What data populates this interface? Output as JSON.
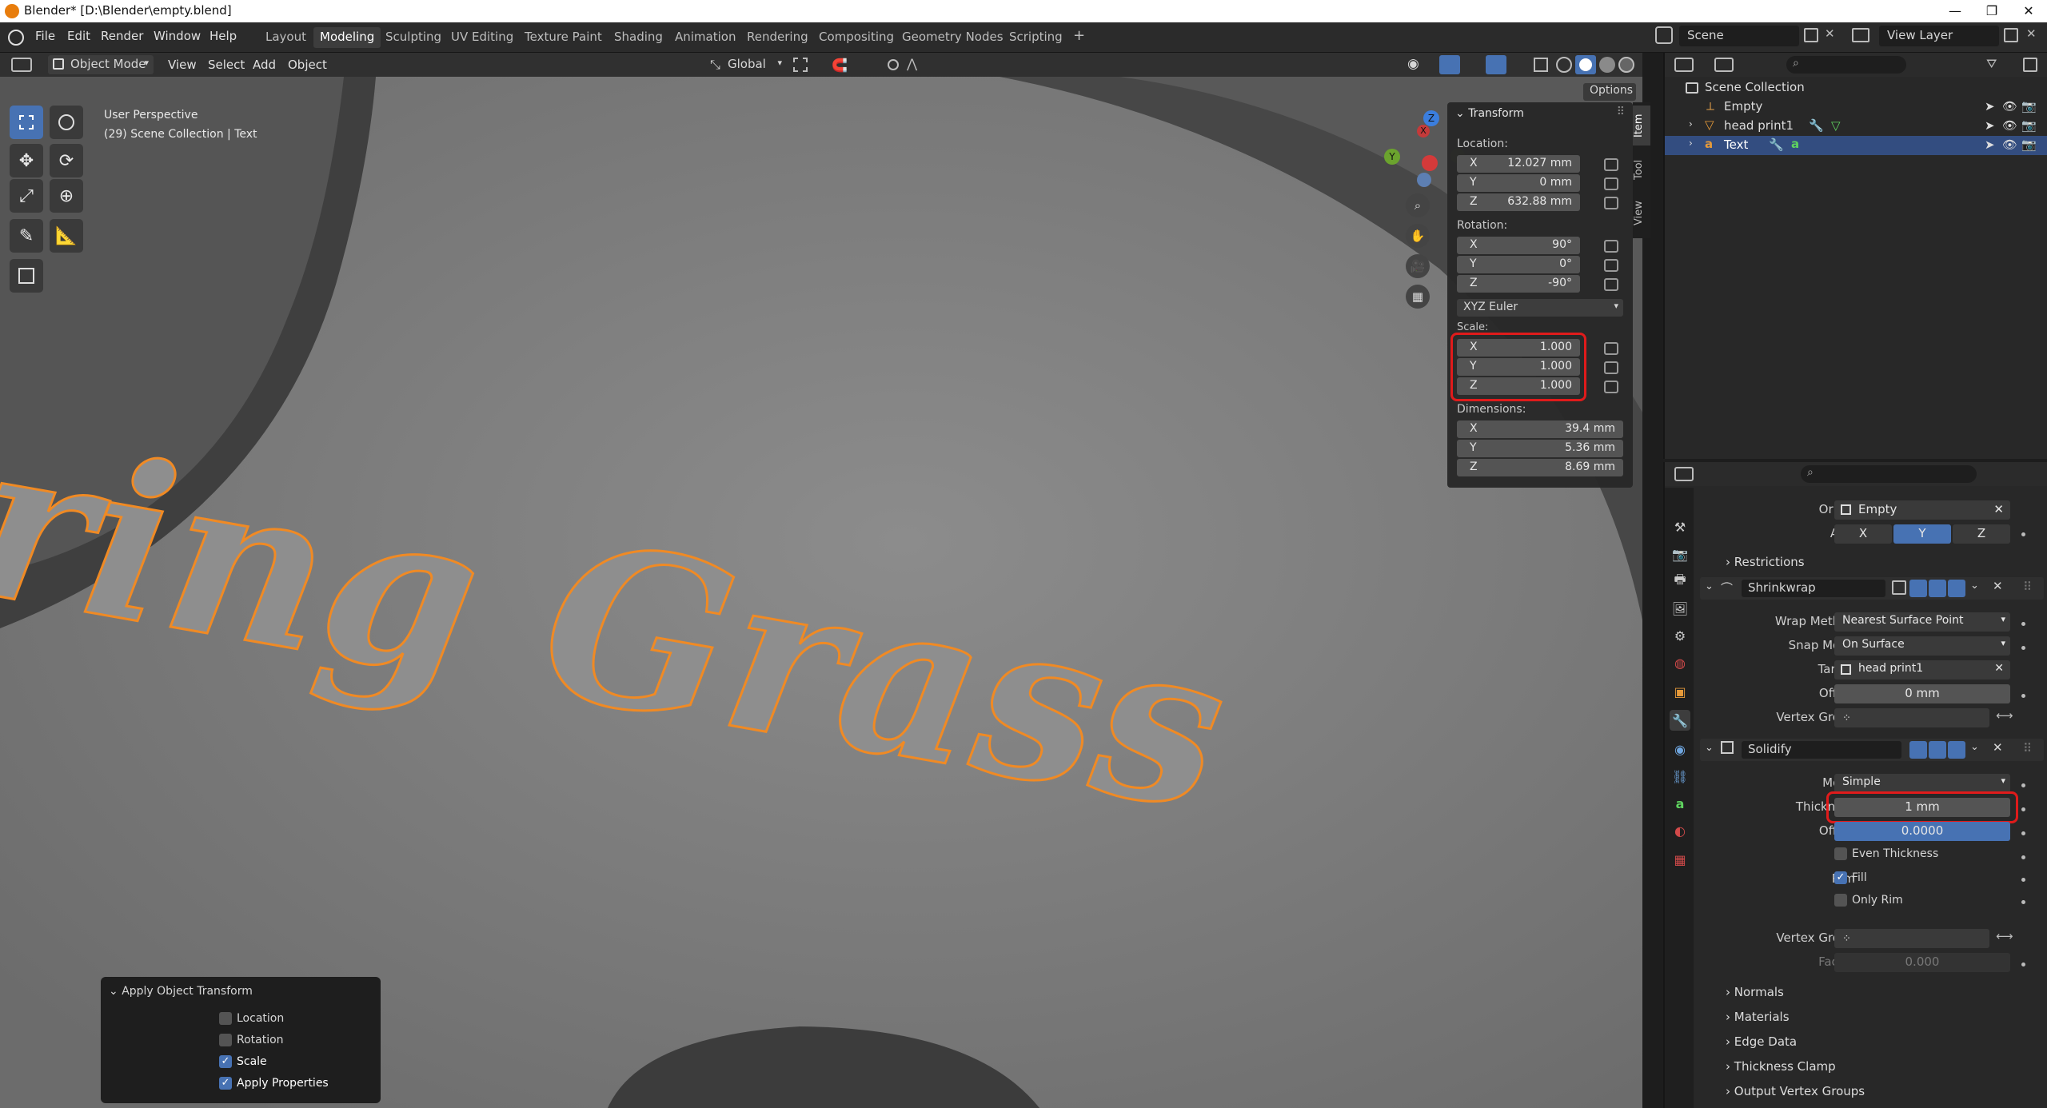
{
  "window": {
    "title": "Blender* [D:\\Blender\\empty.blend]",
    "minimize": "—",
    "restore": "❐",
    "close": "✕"
  },
  "menu": [
    "File",
    "Edit",
    "Render",
    "Window",
    "Help"
  ],
  "workspaces": [
    "Layout",
    "Modeling",
    "Sculpting",
    "UV Editing",
    "Texture Paint",
    "Shading",
    "Animation",
    "Rendering",
    "Compositing",
    "Geometry Nodes",
    "Scripting"
  ],
  "active_workspace": "Modeling",
  "add_workspace": "+",
  "scene": {
    "label": "Scene",
    "view_layer": "View Layer"
  },
  "viewport_header": {
    "mode": "Object Mode",
    "menus": [
      "View",
      "Select",
      "Add",
      "Object"
    ],
    "transform_orientation": "Global",
    "options": "Options"
  },
  "viewport": {
    "perspective": "User Perspective",
    "collection_info": "(29) Scene Collection | Text",
    "scene_text": "ring Grass"
  },
  "gizmo": {
    "z": "Z",
    "y": "Y",
    "x": "X"
  },
  "transform_panel": {
    "title": "Transform",
    "location_label": "Location:",
    "location": [
      {
        "axis": "X",
        "value": "12.027 mm"
      },
      {
        "axis": "Y",
        "value": "0 mm"
      },
      {
        "axis": "Z",
        "value": "632.88 mm"
      }
    ],
    "rotation_label": "Rotation:",
    "rotation": [
      {
        "axis": "X",
        "value": "90°"
      },
      {
        "axis": "Y",
        "value": "0°"
      },
      {
        "axis": "Z",
        "value": "-90°"
      }
    ],
    "rotation_mode": "XYZ Euler",
    "scale_label": "Scale:",
    "scale": [
      {
        "axis": "X",
        "value": "1.000"
      },
      {
        "axis": "Y",
        "value": "1.000"
      },
      {
        "axis": "Z",
        "value": "1.000"
      }
    ],
    "dimensions_label": "Dimensions:",
    "dimensions": [
      {
        "axis": "X",
        "value": "39.4 mm"
      },
      {
        "axis": "Y",
        "value": "5.36 mm"
      },
      {
        "axis": "Z",
        "value": "8.69 mm"
      }
    ]
  },
  "sidebar_tabs": [
    "Item",
    "Tool",
    "View"
  ],
  "outliner": {
    "root": "Scene Collection",
    "items": [
      {
        "name": "Empty",
        "selected": false
      },
      {
        "name": "head print1",
        "selected": false
      },
      {
        "name": "Text",
        "selected": true
      }
    ]
  },
  "properties": {
    "origin_label": "Origin",
    "origin_value": "Empty",
    "axis_label": "Axis",
    "axis_options": [
      "X",
      "Y",
      "Z"
    ],
    "axis_selected": "Y",
    "restrictions": "Restrictions",
    "shrinkwrap": {
      "name": "Shrinkwrap",
      "wrap_method_label": "Wrap Method",
      "wrap_method": "Nearest Surface Point",
      "snap_mode_label": "Snap Mode",
      "snap_mode": "On Surface",
      "target_label": "Target",
      "target": "head print1",
      "offset_label": "Offset",
      "offset": "0 mm",
      "vertex_group_label": "Vertex Group"
    },
    "solidify": {
      "name": "Solidify",
      "mode_label": "Mode",
      "mode": "Simple",
      "thickness_label": "Thickness",
      "thickness": "1 mm",
      "offset_label": "Offset",
      "offset": "0.0000",
      "even_thickness": "Even Thickness",
      "rim_label": "Rim",
      "fill": "Fill",
      "only_rim": "Only Rim",
      "vertex_group_label": "Vertex Group",
      "factor_label": "Factor",
      "factor": "0.000",
      "sections": [
        "Normals",
        "Materials",
        "Edge Data",
        "Thickness Clamp",
        "Output Vertex Groups"
      ]
    }
  },
  "apply_panel": {
    "title": "Apply Object Transform",
    "options": [
      {
        "label": "Location",
        "checked": false
      },
      {
        "label": "Rotation",
        "checked": false
      },
      {
        "label": "Scale",
        "checked": true
      },
      {
        "label": "Apply Properties",
        "checked": true
      }
    ]
  },
  "colors": {
    "accent": "#4772b3",
    "highlight": "#e01b1b",
    "selection": "#f08a24"
  }
}
